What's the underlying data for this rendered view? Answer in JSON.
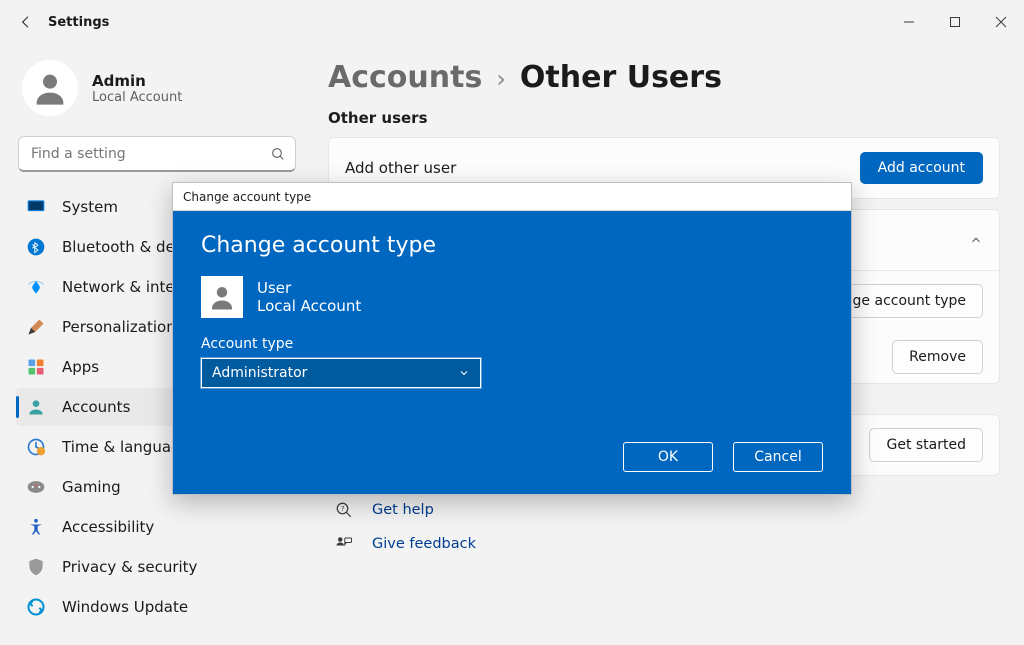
{
  "titlebar": {
    "title": "Settings"
  },
  "profile": {
    "name": "Admin",
    "subtext": "Local Account"
  },
  "search": {
    "placeholder": "Find a setting"
  },
  "sidebar": {
    "items": [
      {
        "label": "System"
      },
      {
        "label": "Bluetooth & devices"
      },
      {
        "label": "Network & internet"
      },
      {
        "label": "Personalization"
      },
      {
        "label": "Apps"
      },
      {
        "label": "Accounts"
      },
      {
        "label": "Time & language"
      },
      {
        "label": "Gaming"
      },
      {
        "label": "Accessibility"
      },
      {
        "label": "Privacy & security"
      },
      {
        "label": "Windows Update"
      }
    ]
  },
  "breadcrumb": {
    "parent": "Accounts",
    "current": "Other Users"
  },
  "section": {
    "heading": "Other users",
    "add_other_label": "Add other user",
    "add_account_btn": "Add account",
    "change_account_type_btn": "Change account type",
    "remove_btn": "Remove",
    "get_started_btn": "Get started"
  },
  "help": {
    "get_help": "Get help",
    "give_feedback": "Give feedback"
  },
  "dialog": {
    "window_title": "Change account type",
    "heading": "Change account type",
    "user_name": "User",
    "user_sub": "Local Account",
    "field_label": "Account type",
    "selected_value": "Administrator",
    "ok": "OK",
    "cancel": "Cancel"
  }
}
